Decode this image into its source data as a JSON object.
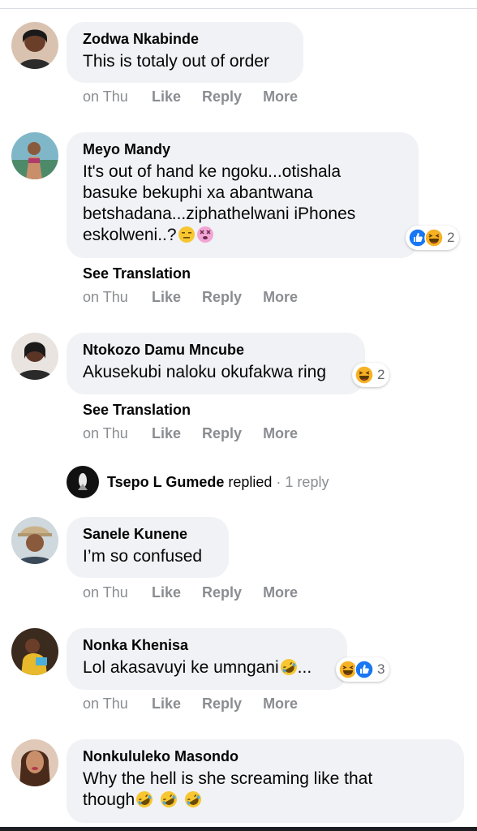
{
  "comments": [
    {
      "name": "Zodwa Nkabinde",
      "lines": [
        "This is totaly out of order"
      ],
      "time": "on Thu",
      "actions": [
        "Like",
        "Reply",
        "More"
      ]
    },
    {
      "name": "Meyo Mandy",
      "lines": [
        "It's out of hand ke ngoku...otishala",
        "basuke bekuphi xa abantwana",
        "betshadana...ziphathelwani iPhones",
        "eskolweni..?"
      ],
      "inline_emojis": [
        "expressionless-face-icon",
        "dizzy-face-icon"
      ],
      "reactions": {
        "icons": [
          "like-reaction-icon",
          "haha-reaction-icon"
        ],
        "count": "2"
      },
      "see_translation": "See Translation",
      "time": "on Thu",
      "actions": [
        "Like",
        "Reply",
        "More"
      ]
    },
    {
      "name": "Ntokozo Damu Mncube",
      "lines": [
        "Akusekubi naloku okufakwa ring"
      ],
      "reactions": {
        "icons": [
          "haha-reaction-icon"
        ],
        "count": "2"
      },
      "see_translation": "See Translation",
      "time": "on Thu",
      "actions": [
        "Like",
        "Reply",
        "More"
      ]
    },
    {
      "name": "Sanele Kunene",
      "lines": [
        "I’m so confused"
      ],
      "time": "on Thu",
      "actions": [
        "Like",
        "Reply",
        "More"
      ]
    },
    {
      "name": "Nonka Khenisa",
      "lines": [
        "Lol akasavuyi ke umngani"
      ],
      "text_suffix": "...",
      "inline_emojis": [
        "rolling-laughing-face-icon"
      ],
      "reactions": {
        "icons": [
          "haha-reaction-icon",
          "like-reaction-icon"
        ],
        "count": "3"
      },
      "time": "on Thu",
      "actions": [
        "Like",
        "Reply",
        "More"
      ]
    },
    {
      "name": "Nonkululeko Masondo",
      "lines": [
        "Why the hell is she screaming like that",
        "though"
      ],
      "inline_emojis": [
        "rolling-laughing-face-icon",
        "rolling-laughing-face-icon",
        "rolling-laughing-face-icon"
      ]
    }
  ],
  "reply_summary": {
    "name": "Tsepo L Gumede",
    "verb": "replied",
    "separator": "·",
    "count": "1 reply"
  },
  "colors": {
    "bubble": "#f0f2f5",
    "meta": "#8a8d91",
    "like_blue": "#1877f2",
    "haha_yellow": "#f7b125"
  }
}
